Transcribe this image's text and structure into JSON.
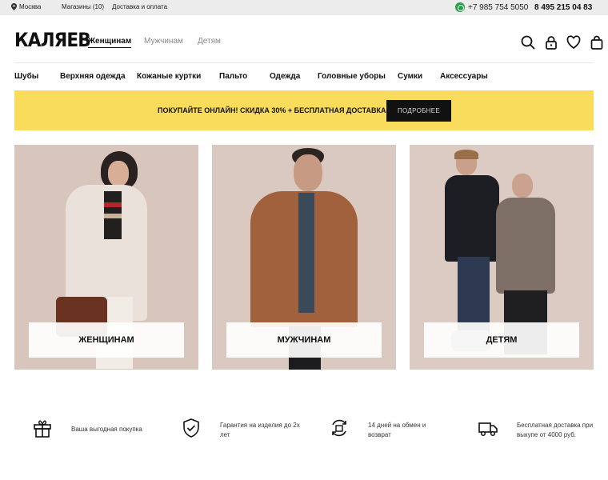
{
  "topbar": {
    "city": "Москва",
    "stores": "Магазины (10)",
    "delivery": "Доставка и оплата",
    "phone_mobile": "+7 985 754 5050",
    "phone_main": "8 495 215 04 83"
  },
  "header": {
    "logo": "КАЛЯЕВ",
    "gender_tabs": [
      "Женщинам",
      "Мужчинам",
      "Детям"
    ],
    "active_tab": "Женщинам",
    "icons": [
      "search-icon",
      "lock-icon",
      "heart-icon",
      "bag-icon"
    ]
  },
  "categories": [
    "Шубы",
    "Верхняя одежда",
    "Кожаные куртки",
    "Пальто",
    "Одежда",
    "Головные уборы",
    "Сумки",
    "Аксессуары"
  ],
  "promo": {
    "text": "ПОКУПАЙТЕ ОНЛАЙН! СКИДКА 30% + БЕСПЛАТНАЯ ДОСТАВКА",
    "button": "ПОДРОБНЕЕ",
    "background": "#fadc5c"
  },
  "cards": [
    {
      "label": "ЖЕНЩИНАМ"
    },
    {
      "label": "МУЖЧИНАМ"
    },
    {
      "label": "ДЕТЯМ"
    }
  ],
  "benefits": [
    {
      "icon": "gift-icon",
      "text": "Ваша выгодная покупка"
    },
    {
      "icon": "shield-check-icon",
      "text": "Гарантия на изделия до 2х лет"
    },
    {
      "icon": "exchange-icon",
      "text": "14 дней на обмен и возврат"
    },
    {
      "icon": "truck-icon",
      "text": "Бесплатная доставка при выкупе от 4000 руб."
    }
  ]
}
